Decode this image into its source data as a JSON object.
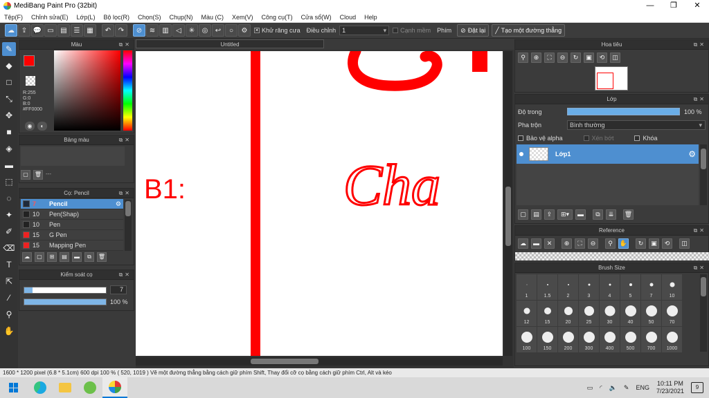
{
  "window": {
    "title": "MediBang Paint Pro (32bit)",
    "controls": [
      "—",
      "❐",
      "✕"
    ]
  },
  "menu": [
    "Tệp(F)",
    "Chỉnh sửa(E)",
    "Lớp(L)",
    "Bộ lọc(R)",
    "Chọn(S)",
    "Chụp(N)",
    "Màu (C)",
    "Xem(V)",
    "Công cụ(T)",
    "Cửa sổ(W)",
    "Cloud",
    "Help"
  ],
  "toolbar": {
    "antialias_label": "Khử răng cưa",
    "correction_label": "Điều chỉnh",
    "correction_value": "1",
    "snap_edge_label": "Cạnh mềm",
    "key_label": "Phím",
    "erase_label": "Đặt lại",
    "straight_line_label": "Tạo một đường thẳng"
  },
  "color_panel": {
    "title": "Màu",
    "fg_color": "#FF0000",
    "bg_color": "#FFFFFF",
    "r": "R:255",
    "g": "G:0",
    "b": "B:0",
    "hex": "#FF0000"
  },
  "palette_panel": {
    "title": "Bảng màu",
    "empty_text": "---"
  },
  "brush_panel": {
    "title": "Cọ: Pencil",
    "brushes": [
      {
        "size": "7",
        "name": "Pencil",
        "color": "#1e2a3a",
        "selected": true
      },
      {
        "size": "10",
        "name": "Pen(Shap)",
        "color": "#222222",
        "selected": false
      },
      {
        "size": "10",
        "name": "Pen",
        "color": "#222222",
        "selected": false
      },
      {
        "size": "15",
        "name": "G Pen",
        "color": "#ee2222",
        "selected": false
      },
      {
        "size": "15",
        "name": "Mapping Pen",
        "color": "#ee2222",
        "selected": false
      }
    ]
  },
  "brush_control": {
    "title": "Kiểm soát cọ",
    "size_value": "7",
    "size_fraction": 0.1,
    "opacity_value": "100 %",
    "opacity_fraction": 1.0
  },
  "canvas": {
    "tab_title": "Untitled",
    "stroke_color": "#FF0000",
    "text_b1": "B1:",
    "text_cha": "Cha"
  },
  "navigator": {
    "title": "Hoa tiêu"
  },
  "layer_panel": {
    "title": "Lớp",
    "opacity_label": "Độ trong",
    "opacity_value": "100 %",
    "blend_label": "Pha trộn",
    "blend_value": "Bình thường",
    "protect_alpha": "Bảo vệ alpha",
    "clipping": "Xén bớt",
    "lock": "Khóa",
    "layer_name": "Lớp1"
  },
  "reference_panel": {
    "title": "Reference"
  },
  "brush_size_panel": {
    "title": "Brush Size",
    "sizes": [
      "1",
      "1.5",
      "2",
      "3",
      "4",
      "5",
      "7",
      "10",
      "12",
      "15",
      "20",
      "25",
      "30",
      "40",
      "50",
      "70",
      "100",
      "150",
      "200",
      "300",
      "400",
      "500",
      "700",
      "1000"
    ]
  },
  "statusbar": {
    "text": "1600 * 1200 pixel   (6.8 * 5.1cm)   600 dpi   100 %   ( 520, 1019 )   Vẽ một đường thẳng bằng cách giữ phím Shift, Thay đổi cỡ cọ bằng cách giữ phím Ctrl, Alt và kéo"
  },
  "taskbar": {
    "language": "ENG",
    "time": "10:11 PM",
    "date": "7/23/2021",
    "notifications": "9"
  }
}
